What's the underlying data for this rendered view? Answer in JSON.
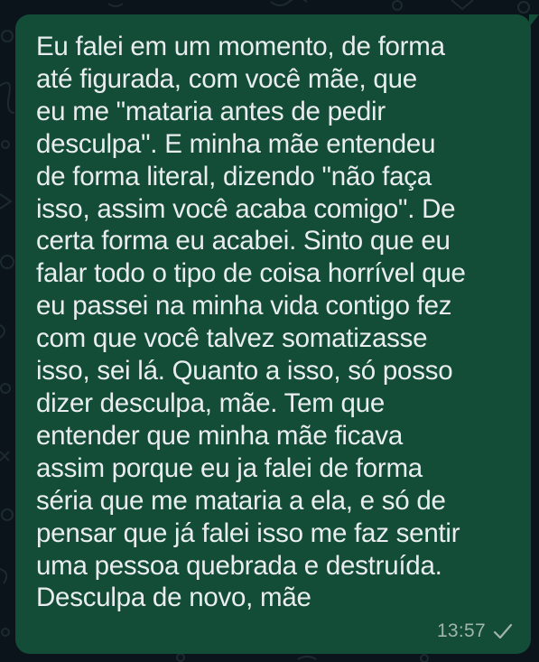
{
  "chat": {
    "message": {
      "text": "Eu falei em um momento, de forma\naté figurada, com você mãe, que\neu me \"mataria antes de pedir\ndesculpa\". E minha mãe entendeu\nde forma literal, dizendo \"não faça\nisso, assim você acaba comigo\". De\ncerta forma eu acabei. Sinto que eu\nfalar todo o tipo de coisa horrível que\neu passei na minha vida contigo fez\ncom que você talvez somatizasse\nisso, sei lá. Quanto a isso, só posso\ndizer desculpa, mãe. Tem que\nentender que minha mãe ficava\nassim porque eu ja falei de forma\nséria que me mataria a ela, e só de\npensar que já falei isso me faz sentir\numa pessoa quebrada e destruída.\nDesculpa de novo, mãe",
      "time": "13:57",
      "status_icon": "single-check-icon",
      "direction": "outgoing"
    }
  },
  "colors": {
    "background": "#0b141a",
    "bubble": "#144d37",
    "text": "#e9edef",
    "meta": "#9fb5a9"
  }
}
